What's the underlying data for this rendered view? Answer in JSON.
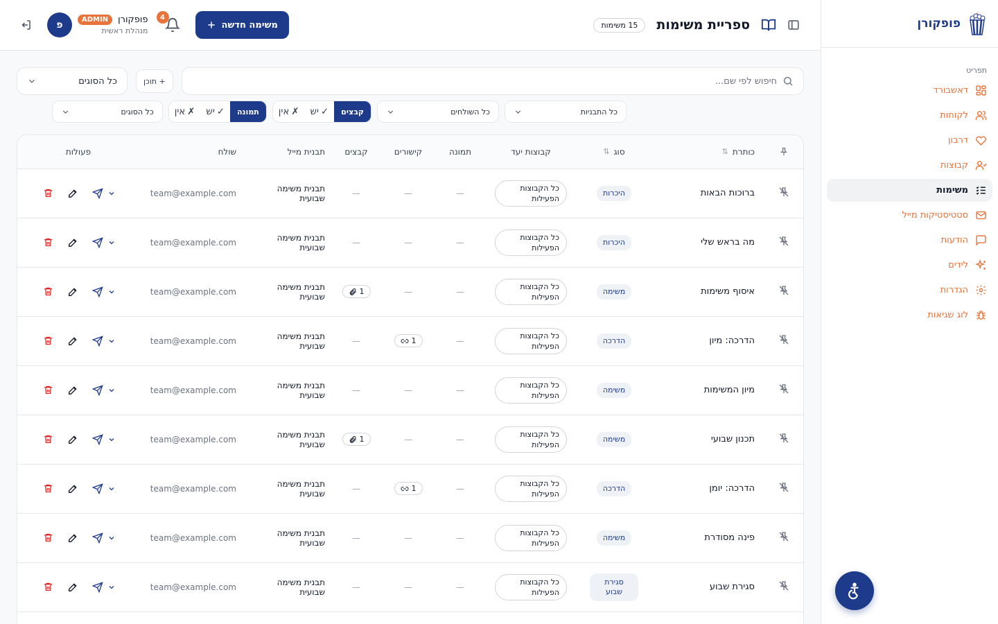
{
  "brand": {
    "name": "פופקורן"
  },
  "sidebar": {
    "menu_heading": "תפריט",
    "items": [
      {
        "label": "דאשבורד",
        "icon": "dashboard-icon"
      },
      {
        "label": "לקוחות",
        "icon": "users-icon"
      },
      {
        "label": "דרבון",
        "icon": "heart-icon"
      },
      {
        "label": "קבוצות",
        "icon": "group-icon"
      },
      {
        "label": "משימות",
        "icon": "tasks-icon",
        "active": true
      },
      {
        "label": "סטטיסטיקות מייל",
        "icon": "mail-icon"
      },
      {
        "label": "הודעות",
        "icon": "message-icon"
      },
      {
        "label": "לידים",
        "icon": "sparkles-icon"
      },
      {
        "label": "הגדרות",
        "icon": "settings-icon"
      },
      {
        "label": "לוג שגיאות",
        "icon": "bug-icon"
      }
    ]
  },
  "header": {
    "title": "ספריית משימות",
    "count_badge": "15 משימות",
    "new_button": "משימה חדשה",
    "notifications_count": "4",
    "user": {
      "name": "פופקורן",
      "role_badge": "ADMIN",
      "role_label": "מנהלת ראשית",
      "avatar_letter": "פ"
    }
  },
  "filters": {
    "search_placeholder": "חיפוש לפי שם...",
    "content_button": "+ תוכן",
    "types_select": "כל הסוגים",
    "templates_select": "כל התבניות",
    "senders_select": "כל השולחים",
    "files_toggle": {
      "label": "קבצים",
      "yes": "יש",
      "no": "אין"
    },
    "image_toggle": {
      "label": "תמונה",
      "yes": "יש",
      "no": "אין"
    },
    "types_select_2": "כל הסוגים"
  },
  "table": {
    "columns": {
      "title": "כותרת",
      "type": "סוג",
      "groups": "קבוצות יעד",
      "image": "תמונה",
      "links": "קישורים",
      "files": "קבצים",
      "template": "תבנית מייל",
      "sender": "שולח",
      "actions": "פעולות"
    },
    "rows": [
      {
        "title": "ברוכות הבאות",
        "type": "היכרות",
        "groups": "כל הקבוצות הפעילות",
        "image": "—",
        "links": "—",
        "files": "—",
        "template": "תבנית משימה שבועית",
        "sender": "team@example.com"
      },
      {
        "title": "מה בראש שלי",
        "type": "היכרות",
        "groups": "כל הקבוצות הפעילות",
        "image": "—",
        "links": "—",
        "files": "—",
        "template": "תבנית משימה שבועית",
        "sender": "team@example.com"
      },
      {
        "title": "איסוף משימות",
        "type": "משימה",
        "groups": "כל הקבוצות הפעילות",
        "image": "—",
        "links": "—",
        "files": "1",
        "template": "תבנית משימה שבועית",
        "sender": "team@example.com"
      },
      {
        "title": "הדרכה: מיון",
        "type": "הדרכה",
        "groups": "כל הקבוצות הפעילות",
        "image": "—",
        "links": "1",
        "files": "—",
        "template": "תבנית משימה שבועית",
        "sender": "team@example.com"
      },
      {
        "title": "מיון המשימות",
        "type": "משימה",
        "groups": "כל הקבוצות הפעילות",
        "image": "—",
        "links": "—",
        "files": "—",
        "template": "תבנית משימה שבועית",
        "sender": "team@example.com"
      },
      {
        "title": "תכנון שבועי",
        "type": "משימה",
        "groups": "כל הקבוצות הפעילות",
        "image": "—",
        "links": "—",
        "files": "1",
        "template": "תבנית משימה שבועית",
        "sender": "team@example.com"
      },
      {
        "title": "הדרכה: יומן",
        "type": "הדרכה",
        "groups": "כל הקבוצות הפעילות",
        "image": "—",
        "links": "1",
        "files": "—",
        "template": "תבנית משימה שבועית",
        "sender": "team@example.com"
      },
      {
        "title": "פינה מסודרת",
        "type": "משימה",
        "groups": "כל הקבוצות הפעילות",
        "image": "—",
        "links": "—",
        "files": "—",
        "template": "תבנית משימה שבועית",
        "sender": "team@example.com"
      },
      {
        "title": "סגירת שבוע",
        "type": "סגירת שבוע",
        "groups": "כל הקבוצות הפעילות",
        "image": "—",
        "links": "—",
        "files": "—",
        "template": "תבנית משימה שבועית",
        "sender": "team@example.com"
      }
    ]
  },
  "colors": {
    "brand_navy": "#1e3a8a",
    "accent_orange": "#e8743b",
    "danger_red": "#dc2626"
  }
}
